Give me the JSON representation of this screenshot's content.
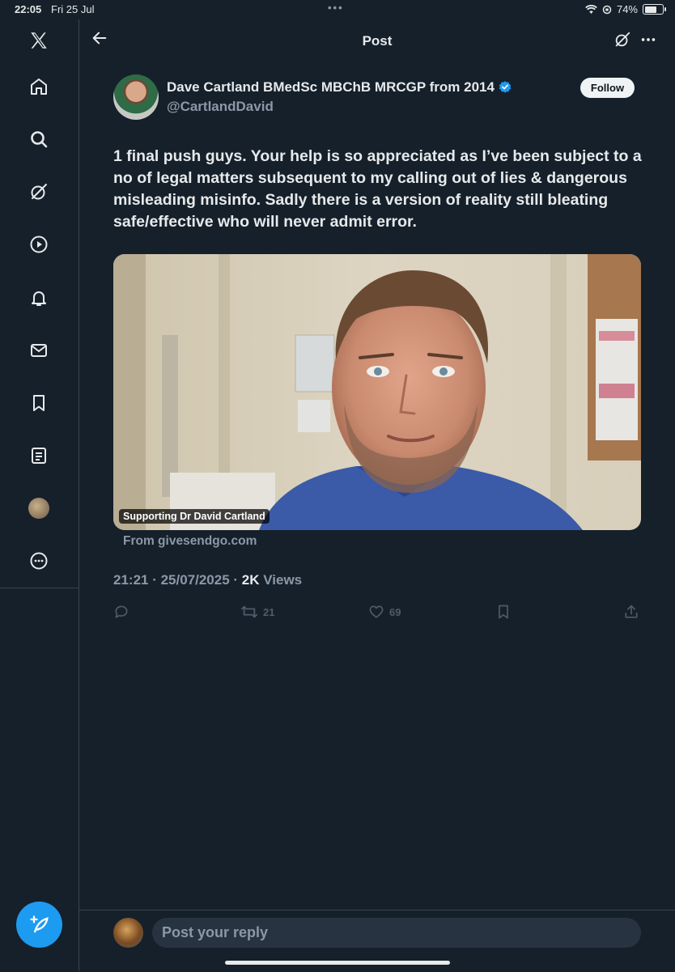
{
  "status_bar": {
    "time": "22:05",
    "date": "Fri 25 Jul",
    "battery": "74%",
    "battery_level": 0.74,
    "icons": [
      "wifi-icon",
      "screen-lock-icon",
      "battery-icon"
    ]
  },
  "sidebar": {
    "items": [
      {
        "name": "x-logo-icon"
      },
      {
        "name": "home-icon"
      },
      {
        "name": "search-icon"
      },
      {
        "name": "grok-icon"
      },
      {
        "name": "video-icon"
      },
      {
        "name": "notifications-icon"
      },
      {
        "name": "messages-icon"
      },
      {
        "name": "bookmarks-icon"
      },
      {
        "name": "lists-icon"
      },
      {
        "name": "profile-avatar"
      },
      {
        "name": "more-icon"
      }
    ]
  },
  "header": {
    "title": "Post"
  },
  "post": {
    "author_name": "Dave Cartland BMedSc MBChB MRCGP from 2014",
    "handle": "@CartlandDavid",
    "follow_label": "Follow",
    "text": "1 final push guys. Your help is so appreciated as I’ve been subject to a no of legal matters subsequent to my calling out of lies & dangerous misleading misinfo. Sadly there is a version of reality still bleating safe/effective who will never admit error.",
    "card": {
      "label": "Supporting Dr David Cartland",
      "source": "From givesendgo.com"
    },
    "timestamp": "21:21 · 25/07/2025 · ",
    "views_count": "2K",
    "views_label": " Views",
    "actions": {
      "reposts": "21",
      "likes": "69"
    }
  },
  "reply": {
    "placeholder": "Post your reply"
  },
  "colors": {
    "background": "#15202b",
    "accent": "#1d9bf0",
    "muted": "#8b98a5"
  }
}
